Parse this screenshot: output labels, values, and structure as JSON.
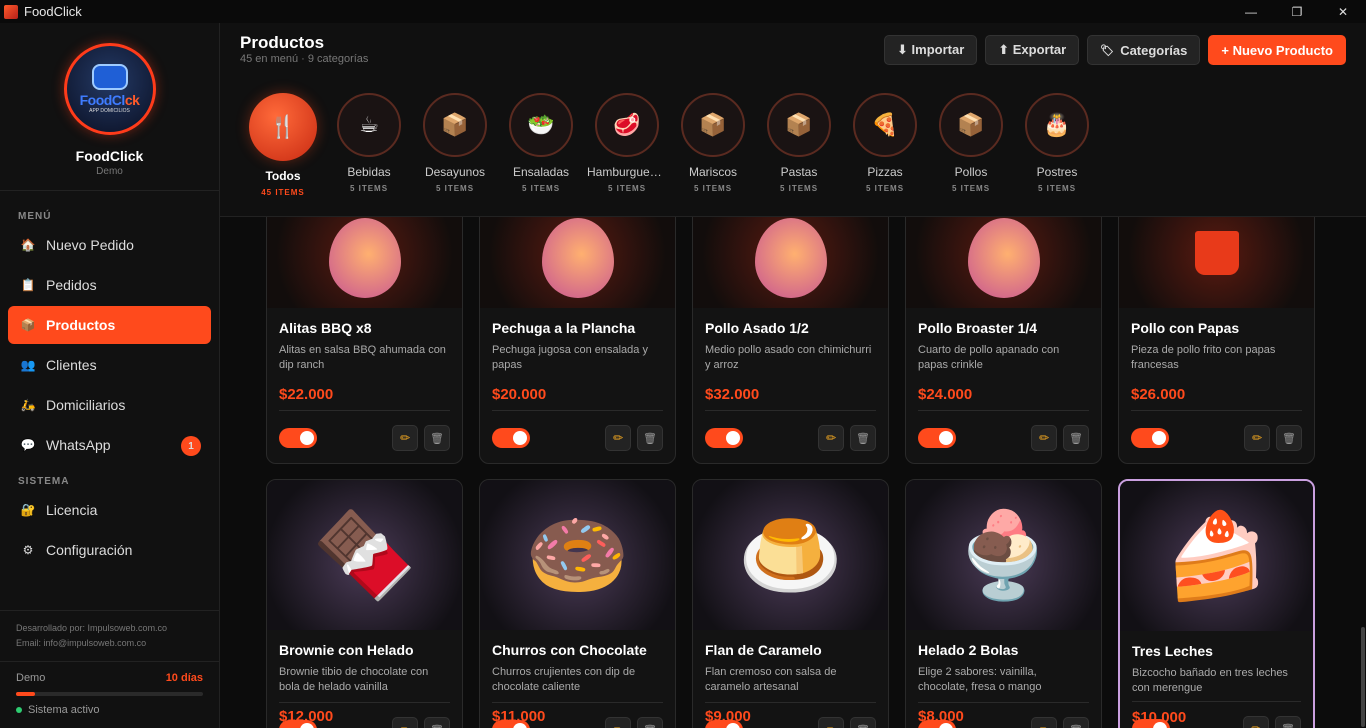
{
  "window": {
    "title": "FoodClick",
    "minimize": "—",
    "maximize": "❐",
    "close": "✕"
  },
  "sidebar": {
    "logo_text_a": "FoodCl",
    "logo_text_b": "ck",
    "logo_sub": "APP DOMICILIOS",
    "brand": "FoodClick",
    "brand_sub": "Demo",
    "menu_label": "MENÚ",
    "menu": [
      {
        "label": "Nuevo Pedido",
        "icon": "🏠"
      },
      {
        "label": "Pedidos",
        "icon": "📋"
      },
      {
        "label": "Productos",
        "icon": "📦"
      },
      {
        "label": "Clientes",
        "icon": "👥"
      },
      {
        "label": "Domiciliarios",
        "icon": "🛵"
      },
      {
        "label": "WhatsApp",
        "icon": "💬",
        "badge": "1"
      }
    ],
    "system_label": "SISTEMA",
    "system": [
      {
        "label": "Licencia",
        "icon": "🔐"
      },
      {
        "label": "Configuración",
        "icon": "⚙"
      }
    ],
    "credits_dev": "Desarrollado por: Impulsoweb.com.co",
    "credits_email": "Email: info@impulsoweb.com.co",
    "trial_label": "Demo",
    "trial_days": "10 días",
    "trial_progress": 0.1,
    "status": "Sistema activo"
  },
  "header": {
    "title": "Productos",
    "subtitle": "45 en menú · 9 categorías",
    "buttons": {
      "import": "⬇ Importar",
      "export": "⬆ Exportar",
      "categories": "Categorías",
      "new": "+ Nuevo Producto"
    }
  },
  "categories": [
    {
      "name": "Todos",
      "count": "45 ITEMS",
      "icon": "🍴"
    },
    {
      "name": "Bebidas",
      "count": "5 ITEMS",
      "icon": "☕"
    },
    {
      "name": "Desayunos",
      "count": "5 ITEMS",
      "icon": "📦"
    },
    {
      "name": "Ensaladas",
      "count": "5 ITEMS",
      "icon": "🥗"
    },
    {
      "name": "Hamburguesas",
      "count": "5 ITEMS",
      "icon": "🥩"
    },
    {
      "name": "Mariscos",
      "count": "5 ITEMS",
      "icon": "📦"
    },
    {
      "name": "Pastas",
      "count": "5 ITEMS",
      "icon": "📦"
    },
    {
      "name": "Pizzas",
      "count": "5 ITEMS",
      "icon": "🍕"
    },
    {
      "name": "Pollos",
      "count": "5 ITEMS",
      "icon": "📦"
    },
    {
      "name": "Postres",
      "count": "5 ITEMS",
      "icon": "🎂"
    }
  ],
  "products_row1": [
    {
      "name": "Alitas BBQ x8",
      "desc": "Alitas en salsa BBQ ahumada con dip ranch",
      "price": "$22.000",
      "img": "drumstick"
    },
    {
      "name": "Pechuga a la Plancha",
      "desc": "Pechuga jugosa con ensalada y papas",
      "price": "$20.000",
      "img": "drumstick"
    },
    {
      "name": "Pollo Asado 1/2",
      "desc": "Medio pollo asado con chimichurri y arroz",
      "price": "$32.000",
      "img": "drumstick"
    },
    {
      "name": "Pollo Broaster 1/4",
      "desc": "Cuarto de pollo apanado con papas crinkle",
      "price": "$24.000",
      "img": "drumstick"
    },
    {
      "name": "Pollo con Papas",
      "desc": "Pieza de pollo frito con papas francesas",
      "price": "$26.000",
      "img": "fries"
    }
  ],
  "products_row2": [
    {
      "name": "Brownie con Helado",
      "desc": "Brownie tibio de chocolate con bola de helado vainilla",
      "price": "$12.000",
      "img": "🍫"
    },
    {
      "name": "Churros con Chocolate",
      "desc": "Churros crujientes con dip de chocolate caliente",
      "price": "$11.000",
      "img": "🍩"
    },
    {
      "name": "Flan de Caramelo",
      "desc": "Flan cremoso con salsa de caramelo artesanal",
      "price": "$9.000",
      "img": "🍮"
    },
    {
      "name": "Helado 2 Bolas",
      "desc": "Elige 2 sabores: vainilla, chocolate, fresa o mango",
      "price": "$8.000",
      "img": "🍨"
    },
    {
      "name": "Tres Leches",
      "desc": "Bizcocho bañado en tres leches con merengue",
      "price": "$10.000",
      "img": "🍰"
    }
  ],
  "icons": {
    "edit": "✏",
    "delete": "🗑",
    "tag": "🏷"
  },
  "colors": {
    "accent": "#ff4a1c",
    "bg": "#0c0c0c",
    "sidebar": "#111111"
  }
}
